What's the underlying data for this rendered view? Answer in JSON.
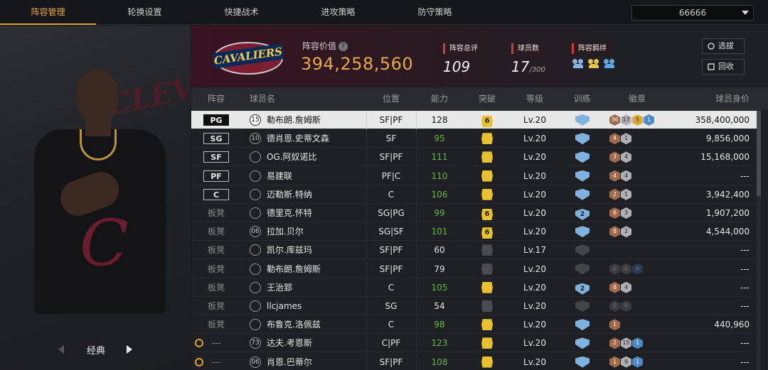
{
  "nav": {
    "tabs": [
      "阵容管理",
      "轮换设置",
      "快捷战术",
      "进攻策略",
      "防守策略"
    ],
    "active_index": 0,
    "selector_value": "66666"
  },
  "left_panel": {
    "bg_text": "CLEVELAND",
    "style_label": "经典"
  },
  "header": {
    "team_logo_text": "CAVALIERS",
    "value_label": "阵容价值",
    "value": "394,258,560",
    "rating_label": "阵容总评",
    "rating": "109",
    "count_label": "球员数",
    "count": "17",
    "count_max": "/300",
    "bond_label": "阵容羁绊",
    "select_button": "选拔",
    "recycle_button": "回收"
  },
  "table": {
    "headers": [
      "阵容",
      "球员名",
      "位置",
      "能力",
      "突破",
      "等级",
      "训练",
      "徽章",
      "球员身价"
    ],
    "rows": [
      {
        "slot": "PG",
        "starter": true,
        "selected": true,
        "icon": "15",
        "name": "勒布朗.詹姆斯",
        "pos": "SF|PF",
        "ability": "128",
        "ability_green": false,
        "breakthrough": "6",
        "bt_active": true,
        "level": "Lv.20",
        "training": "",
        "train_active": true,
        "badges": [
          {
            "t": "br",
            "v": "36"
          },
          {
            "t": "sv",
            "v": "17"
          },
          {
            "t": "gd",
            "v": "5"
          },
          {
            "t": "bl",
            "v": "1"
          }
        ],
        "value": "358,400,000",
        "lock": false
      },
      {
        "slot": "SG",
        "starter": true,
        "selected": false,
        "icon": "10",
        "name": "德肖恩.史蒂文森",
        "pos": "SF",
        "ability": "95",
        "ability_green": true,
        "breakthrough": "",
        "bt_active": true,
        "level": "Lv.20",
        "training": "",
        "train_active": true,
        "badges": [
          {
            "t": "br",
            "v": "4"
          },
          {
            "t": "sv",
            "v": "1"
          }
        ],
        "value": "9,856,000",
        "lock": false
      },
      {
        "slot": "SF",
        "starter": true,
        "selected": false,
        "icon": "",
        "name": "OG.阿奴诺比",
        "pos": "SF|PF",
        "ability": "111",
        "ability_green": true,
        "breakthrough": "",
        "bt_active": true,
        "level": "Lv.20",
        "training": "",
        "train_active": true,
        "badges": [
          {
            "t": "br",
            "v": "3"
          },
          {
            "t": "sv",
            "v": "4"
          }
        ],
        "value": "15,168,000",
        "lock": false
      },
      {
        "slot": "PF",
        "starter": true,
        "selected": false,
        "icon": "",
        "name": "易建联",
        "pos": "PF|C",
        "ability": "110",
        "ability_green": true,
        "breakthrough": "",
        "bt_active": true,
        "level": "Lv.20",
        "training": "",
        "train_active": true,
        "badges": [
          {
            "t": "br",
            "v": "4"
          },
          {
            "t": "sv",
            "v": "4"
          }
        ],
        "value": "---",
        "lock": false
      },
      {
        "slot": "C",
        "starter": true,
        "selected": false,
        "icon": "",
        "name": "迈勒斯.特纳",
        "pos": "C",
        "ability": "106",
        "ability_green": true,
        "breakthrough": "",
        "bt_active": true,
        "level": "Lv.20",
        "training": "",
        "train_active": true,
        "badges": [
          {
            "t": "br",
            "v": "2"
          },
          {
            "t": "sv",
            "v": "1"
          }
        ],
        "value": "3,942,400",
        "lock": false
      },
      {
        "slot": "板凳",
        "starter": false,
        "selected": false,
        "icon": "",
        "name": "德里克.怀特",
        "pos": "SG|PG",
        "ability": "99",
        "ability_green": true,
        "breakthrough": "6",
        "bt_active": true,
        "level": "Lv.20",
        "training": "2",
        "train_active": true,
        "badges": [
          {
            "t": "br",
            "v": "6"
          },
          {
            "t": "sv",
            "v": "3"
          }
        ],
        "value": "1,907,200",
        "lock": false
      },
      {
        "slot": "板凳",
        "starter": false,
        "selected": false,
        "icon": "06",
        "name": "拉加.贝尔",
        "pos": "SG|SF",
        "ability": "101",
        "ability_green": true,
        "breakthrough": "6",
        "bt_active": true,
        "level": "Lv.20",
        "training": "",
        "train_active": true,
        "badges": [
          {
            "t": "br",
            "v": "8"
          },
          {
            "t": "sv",
            "v": "2"
          }
        ],
        "value": "4,544,000",
        "lock": false
      },
      {
        "slot": "板凳",
        "starter": false,
        "selected": false,
        "icon": "",
        "name": "凯尔.库兹玛",
        "pos": "SF|PF",
        "ability": "60",
        "ability_green": false,
        "breakthrough": "",
        "bt_active": false,
        "level": "Lv.17",
        "training": "",
        "train_active": false,
        "badges": [],
        "value": "---",
        "lock": false
      },
      {
        "slot": "板凳",
        "starter": false,
        "selected": false,
        "icon": "",
        "name": "勒布朗.詹姆斯",
        "pos": "SF|PF",
        "ability": "79",
        "ability_green": false,
        "breakthrough": "",
        "bt_active": false,
        "level": "Lv.20",
        "training": "",
        "train_active": false,
        "badges": [
          {
            "t": "dk",
            "v": "0"
          },
          {
            "t": "dk",
            "v": "0"
          },
          {
            "t": "dkb",
            "v": "0"
          }
        ],
        "value": "---",
        "lock": false
      },
      {
        "slot": "板凳",
        "starter": false,
        "selected": false,
        "icon": "",
        "name": "王治郅",
        "pos": "C",
        "ability": "105",
        "ability_green": true,
        "breakthrough": "",
        "bt_active": true,
        "level": "Lv.20",
        "training": "2",
        "train_active": true,
        "badges": [
          {
            "t": "br",
            "v": "8"
          },
          {
            "t": "sv",
            "v": "4"
          }
        ],
        "value": "---",
        "lock": false
      },
      {
        "slot": "板凳",
        "starter": false,
        "selected": false,
        "icon": "",
        "name": "llcjames",
        "pos": "SG",
        "ability": "54",
        "ability_green": false,
        "breakthrough": "",
        "bt_active": false,
        "level": "Lv.20",
        "training": "",
        "train_active": false,
        "badges": [
          {
            "t": "dk",
            "v": "0"
          },
          {
            "t": "dk",
            "v": "0"
          }
        ],
        "value": "---",
        "lock": false
      },
      {
        "slot": "板凳",
        "starter": false,
        "selected": false,
        "icon": "",
        "name": "布鲁克.洛佩兹",
        "pos": "C",
        "ability": "98",
        "ability_green": true,
        "breakthrough": "",
        "bt_active": true,
        "level": "Lv.20",
        "training": "",
        "train_active": true,
        "badges": [
          {
            "t": "br",
            "v": "1"
          }
        ],
        "value": "440,960",
        "lock": false
      },
      {
        "slot": "---",
        "starter": false,
        "selected": false,
        "icon": "73",
        "name": "达夫.考恩斯",
        "pos": "C|PF",
        "ability": "123",
        "ability_green": true,
        "breakthrough": "",
        "bt_active": true,
        "level": "Lv.20",
        "training": "",
        "train_active": true,
        "badges": [
          {
            "t": "br",
            "v": "2"
          },
          {
            "t": "sv",
            "v": "15"
          },
          {
            "t": "bl",
            "v": "1"
          }
        ],
        "value": "---",
        "lock": true
      },
      {
        "slot": "---",
        "starter": false,
        "selected": false,
        "icon": "06",
        "name": "肖恩.巴蒂尔",
        "pos": "SF|PF",
        "ability": "108",
        "ability_green": true,
        "breakthrough": "",
        "bt_active": true,
        "level": "Lv.20",
        "training": "",
        "train_active": true,
        "badges": [
          {
            "t": "br",
            "v": "1"
          },
          {
            "t": "sv",
            "v": "9"
          },
          {
            "t": "bl",
            "v": "1"
          }
        ],
        "value": "---",
        "lock": true
      }
    ]
  }
}
